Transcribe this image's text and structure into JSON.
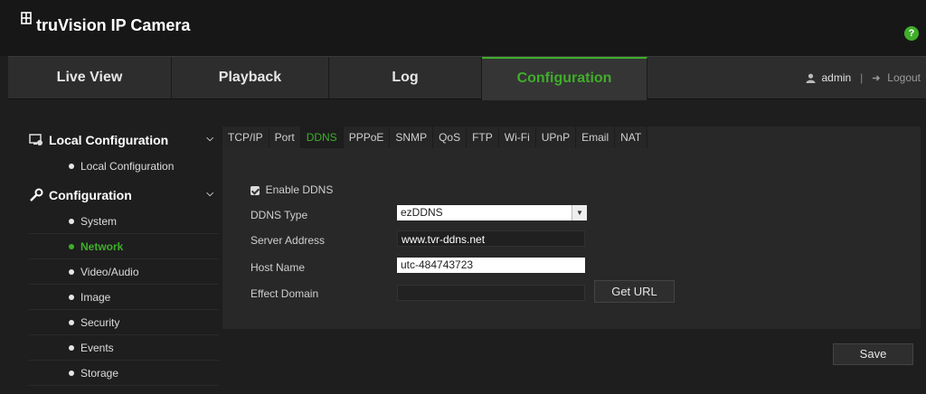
{
  "app": {
    "title": "truVision IP Camera"
  },
  "nav": {
    "tabs": [
      "Live View",
      "Playback",
      "Log",
      "Configuration"
    ],
    "active": "Configuration",
    "user": "admin",
    "logout": "Logout"
  },
  "sidebar": {
    "groups": [
      {
        "label": "Local Configuration",
        "icon": "local-config-icon",
        "items": [
          "Local Configuration"
        ]
      },
      {
        "label": "Configuration",
        "icon": "wrench-icon",
        "items": [
          "System",
          "Network",
          "Video/Audio",
          "Image",
          "Security",
          "Events",
          "Storage"
        ]
      }
    ],
    "active_item": "Network"
  },
  "tabs": [
    "TCP/IP",
    "Port",
    "DDNS",
    "PPPoE",
    "SNMP",
    "QoS",
    "FTP",
    "Wi-Fi",
    "UPnP",
    "Email",
    "NAT"
  ],
  "active_tab": "DDNS",
  "form": {
    "enable_label": "Enable DDNS",
    "enabled": true,
    "ddns_type_label": "DDNS Type",
    "ddns_type_value": "ezDDNS",
    "server_address_label": "Server Address",
    "server_address_value": "www.tvr-ddns.net",
    "host_name_label": "Host Name",
    "host_name_value": "utc-484743723",
    "effect_domain_label": "Effect Domain",
    "effect_domain_value": "",
    "get_url_label": "Get URL"
  },
  "save_label": "Save",
  "colors": {
    "accent": "#3fae2a",
    "background": "#1e1e1e",
    "panel": "#282828"
  }
}
